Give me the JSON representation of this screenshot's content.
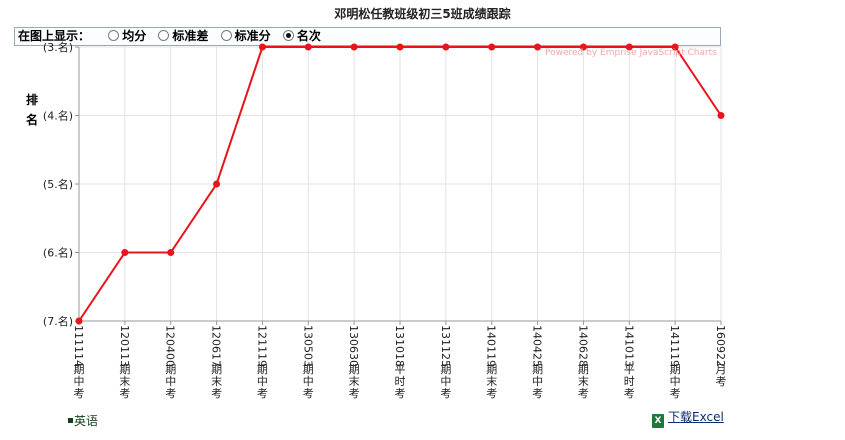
{
  "title": "邓明松任教班级初三5班成绩跟踪",
  "controls": {
    "label": "在图上显示：",
    "options": [
      {
        "label": "均分",
        "selected": false
      },
      {
        "label": "标准差",
        "selected": false
      },
      {
        "label": "标准分",
        "selected": false
      },
      {
        "label": "名次",
        "selected": true
      }
    ]
  },
  "watermark": "Powered by Emprise JavaScript Charts",
  "legend": {
    "series_label": "英语"
  },
  "download": {
    "label": "下载Excel",
    "icon": "excel-icon"
  },
  "chart_data": {
    "type": "line",
    "title": "邓明松任教班级初三5班成绩跟踪",
    "ylabel": "排名",
    "ylim": [
      3,
      7
    ],
    "y_inverted": true,
    "y_ticks": [
      "(3.名)",
      "(4.名)",
      "(5.名)",
      "(6.名)",
      "(7.名)"
    ],
    "grid": true,
    "categories": [
      {
        "code": "111114",
        "exam": "期中考"
      },
      {
        "code": "120113",
        "exam": "期末考"
      },
      {
        "code": "120400",
        "exam": "期中考"
      },
      {
        "code": "120617",
        "exam": "期末考"
      },
      {
        "code": "121119",
        "exam": "期中考"
      },
      {
        "code": "130503",
        "exam": "期中考"
      },
      {
        "code": "130630",
        "exam": "期末考"
      },
      {
        "code": "131018",
        "exam": "平时考"
      },
      {
        "code": "131125",
        "exam": "期中考"
      },
      {
        "code": "140119",
        "exam": "期末考"
      },
      {
        "code": "140425",
        "exam": "期中考"
      },
      {
        "code": "140628",
        "exam": "期末考"
      },
      {
        "code": "141013",
        "exam": "平时考"
      },
      {
        "code": "141119",
        "exam": "期中考"
      },
      {
        "code": "160922",
        "exam": "月考"
      }
    ],
    "series": [
      {
        "name": "英语",
        "color": "#e8141b",
        "values": [
          7,
          6,
          6,
          5,
          3,
          3,
          3,
          3,
          3,
          3,
          3,
          3,
          3,
          3,
          4
        ]
      }
    ]
  }
}
